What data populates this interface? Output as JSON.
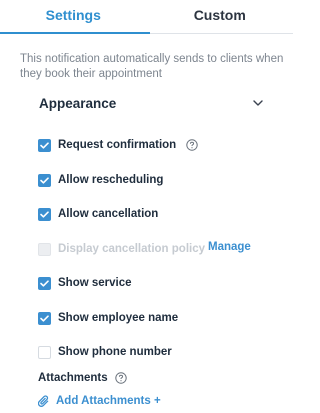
{
  "tabs": [
    {
      "label": "Settings",
      "active": true
    },
    {
      "label": "Custom",
      "active": false
    }
  ],
  "description": "This notification automatically sends to clients when they book their appointment",
  "appearance": {
    "title": "Appearance"
  },
  "options": [
    {
      "label": "Request confirmation",
      "checked": true,
      "disabled": false,
      "help": true
    },
    {
      "label": "Allow rescheduling",
      "checked": true,
      "disabled": false
    },
    {
      "label": "Allow cancellation",
      "checked": true,
      "disabled": false
    },
    {
      "label": "Display cancellation policy",
      "checked": false,
      "disabled": true,
      "link": "Manage"
    },
    {
      "label": "Show service",
      "checked": true,
      "disabled": false
    },
    {
      "label": "Show employee name",
      "checked": true,
      "disabled": false
    },
    {
      "label": "Show phone number",
      "checked": false,
      "disabled": false
    }
  ],
  "attachments": {
    "label": "Attachments",
    "add_label": "Add Attachments +"
  },
  "colors": {
    "accent": "#3b8fd0",
    "text": "#1f2d3d",
    "muted": "#7d858f",
    "disabled": "#c6cbd1"
  }
}
